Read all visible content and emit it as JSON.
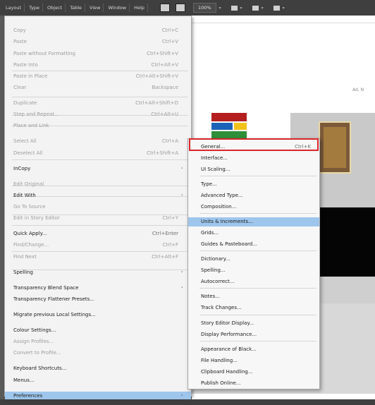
{
  "menubar": {
    "items": [
      "Layout",
      "Type",
      "Object",
      "Table",
      "View",
      "Window",
      "Help"
    ],
    "zoom": "100%"
  },
  "canvas": {
    "right_label": "Ad. N",
    "caption_1": "",
    "mid_text": "",
    "bottom_text": ""
  },
  "edit_menu": {
    "items": [
      {
        "label": "Copy",
        "shortcut": "Ctrl+C",
        "disabled": true
      },
      {
        "label": "Paste",
        "shortcut": "Ctrl+V",
        "disabled": true
      },
      {
        "label": "Paste without Formatting",
        "shortcut": "Ctrl+Shift+V",
        "disabled": true
      },
      {
        "label": "Paste Into",
        "shortcut": "Ctrl+Alt+V",
        "disabled": true
      },
      {
        "label": "Paste in Place",
        "shortcut": "Ctrl+Alt+Shift+V",
        "disabled": true
      },
      {
        "label": "Clear",
        "shortcut": "Backspace",
        "disabled": true
      },
      {
        "label": "Duplicate",
        "shortcut": "Ctrl+Alt+Shift+D",
        "disabled": true
      },
      {
        "label": "Step and Repeat...",
        "shortcut": "Ctrl+Alt+U",
        "disabled": true
      },
      {
        "label": "Place and Link",
        "shortcut": "",
        "disabled": true
      },
      {
        "label": "Select All",
        "shortcut": "Ctrl+A",
        "disabled": true
      },
      {
        "label": "Deselect All",
        "shortcut": "Ctrl+Shift+A",
        "disabled": true
      },
      {
        "label": "InCopy",
        "shortcut": "",
        "disabled": false,
        "submenu": true
      },
      {
        "label": "Edit Original",
        "shortcut": "",
        "disabled": true
      },
      {
        "label": "Edit With",
        "shortcut": "",
        "disabled": false,
        "submenu": true
      },
      {
        "label": "Go To Source",
        "shortcut": "",
        "disabled": true
      },
      {
        "label": "Edit in Story Editor",
        "shortcut": "Ctrl+Y",
        "disabled": true
      },
      {
        "label": "Quick Apply...",
        "shortcut": "Ctrl+Enter",
        "disabled": false
      },
      {
        "label": "Find/Change...",
        "shortcut": "Ctrl+F",
        "disabled": true
      },
      {
        "label": "Find Next",
        "shortcut": "Ctrl+Alt+F",
        "disabled": true
      },
      {
        "label": "Spelling",
        "shortcut": "",
        "disabled": false,
        "submenu": true
      },
      {
        "label": "Transparency Blend Space",
        "shortcut": "",
        "disabled": false,
        "submenu": true
      },
      {
        "label": "Transparency Flattener Presets...",
        "shortcut": "",
        "disabled": false
      },
      {
        "label": "Migrate previous Local Settings...",
        "shortcut": "",
        "disabled": false
      },
      {
        "label": "Colour Settings...",
        "shortcut": "",
        "disabled": false
      },
      {
        "label": "Assign Profiles...",
        "shortcut": "",
        "disabled": true
      },
      {
        "label": "Convert to Profile...",
        "shortcut": "",
        "disabled": true
      },
      {
        "label": "Keyboard Shortcuts...",
        "shortcut": "",
        "disabled": false
      },
      {
        "label": "Menus...",
        "shortcut": "",
        "disabled": false
      },
      {
        "label": "Preferences",
        "shortcut": "",
        "disabled": false,
        "submenu": true,
        "selected": true
      }
    ]
  },
  "prefs_submenu": {
    "items": [
      {
        "label": "General...",
        "shortcut": "Ctrl+K"
      },
      {
        "label": "Interface..."
      },
      {
        "label": "UI Scaling..."
      },
      {
        "label": "Type..."
      },
      {
        "label": "Advanced Type..."
      },
      {
        "label": "Composition..."
      },
      {
        "label": "Units & Increments...",
        "selected": true
      },
      {
        "label": "Grids..."
      },
      {
        "label": "Guides & Pasteboard..."
      },
      {
        "label": "Dictionary..."
      },
      {
        "label": "Spelling..."
      },
      {
        "label": "Autocorrect..."
      },
      {
        "label": "Notes..."
      },
      {
        "label": "Track Changes..."
      },
      {
        "label": "Story Editor Display..."
      },
      {
        "label": "Display Performance..."
      },
      {
        "label": "Appearance of Black..."
      },
      {
        "label": "File Handling..."
      },
      {
        "label": "Clipboard Handling..."
      },
      {
        "label": "Publish Online..."
      }
    ]
  },
  "colors": {
    "selection": "#9ec6ec",
    "highlight_box": "#d9262b"
  },
  "icons": {
    "submenu_arrow": "chevron-right-icon"
  }
}
